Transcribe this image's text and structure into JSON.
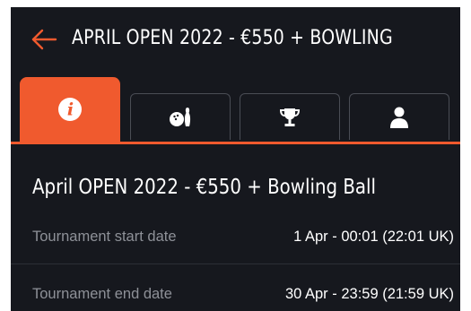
{
  "header": {
    "title": "APRIL OPEN 2022 - €550 + BOWLING B..."
  },
  "tabs": [
    {
      "icon": "info-icon",
      "active": true
    },
    {
      "icon": "bowling-icon",
      "active": false
    },
    {
      "icon": "trophy-icon",
      "active": false
    },
    {
      "icon": "person-icon",
      "active": false
    }
  ],
  "event": {
    "title": "April OPEN 2022 - €550 + Bowling Ball",
    "rows": [
      {
        "label": "Tournament start date",
        "value": "1 Apr - 00:01 (22:01 UK)"
      },
      {
        "label": "Tournament end date",
        "value": "30 Apr - 23:59 (21:59 UK)"
      }
    ]
  },
  "colors": {
    "accent": "#f05a2e",
    "background": "#16181e",
    "label": "#8e9198",
    "tab_border": "#4a4d55"
  }
}
